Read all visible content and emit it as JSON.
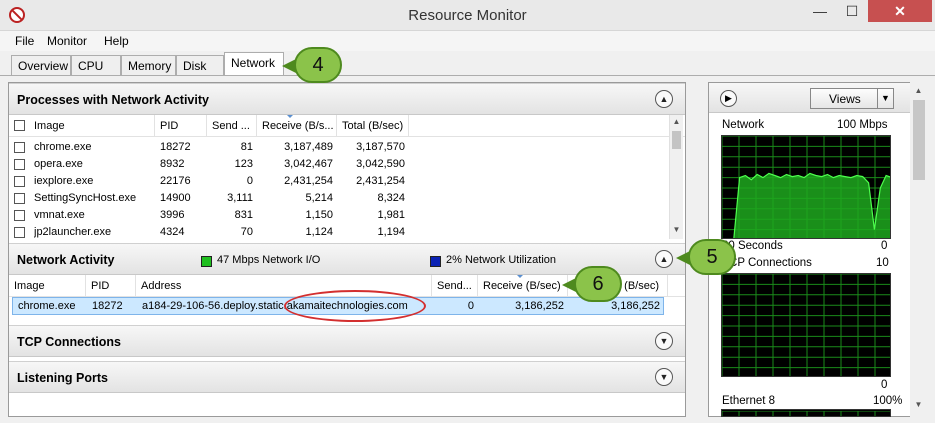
{
  "window": {
    "title": "Resource Monitor",
    "min": "—",
    "max": "☐",
    "close": "✕"
  },
  "menu": [
    "File",
    "Monitor",
    "Help"
  ],
  "tabs": [
    "Overview",
    "CPU",
    "Memory",
    "Disk",
    "Network"
  ],
  "processes": {
    "title": "Processes with Network Activity",
    "headers": [
      "Image",
      "PID",
      "Send ...",
      "Receive (B/s...",
      "Total (B/sec)"
    ],
    "rows": [
      [
        "chrome.exe",
        "18272",
        "81",
        "3,187,489",
        "3,187,570"
      ],
      [
        "opera.exe",
        "8932",
        "123",
        "3,042,467",
        "3,042,590"
      ],
      [
        "iexplore.exe",
        "22176",
        "0",
        "2,431,254",
        "2,431,254"
      ],
      [
        "SettingSyncHost.exe",
        "14900",
        "3,111",
        "5,214",
        "8,324"
      ],
      [
        "vmnat.exe",
        "3996",
        "831",
        "1,150",
        "1,981"
      ],
      [
        "jp2launcher.exe",
        "4324",
        "70",
        "1,124",
        "1,194"
      ]
    ]
  },
  "network_activity": {
    "title": "Network Activity",
    "io_label": "47 Mbps Network I/O",
    "util_label": "2% Network Utilization",
    "io_color": "#1fbf1f",
    "util_color": "#0a22b4",
    "headers": [
      "Image",
      "PID",
      "Address",
      "Send...",
      "Receive (B/sec)",
      "(B/sec)"
    ],
    "rows": [
      [
        "chrome.exe",
        "18272",
        "a184-29-106-56.deploy.static.akamaitechnologies.com",
        "0",
        "3,186,252",
        "3,186,252"
      ]
    ]
  },
  "tcp": {
    "title": "TCP Connections"
  },
  "listening": {
    "title": "Listening Ports"
  },
  "right": {
    "views_label": "Views",
    "network_graph": {
      "label": "Network",
      "max": "100 Mbps",
      "footer_left": "60 Seconds",
      "footer_right": "0"
    },
    "tcp_graph": {
      "label": "TCP Connections",
      "max": "10",
      "footer_right": "0"
    },
    "ethernet_graph": {
      "label": "Ethernet 8",
      "max": "100%"
    }
  },
  "callouts": [
    "4",
    "5",
    "6"
  ],
  "colors": {
    "graph_grid": "#1a8a1a",
    "graph_fill": "#1fa81f",
    "graph_line": "#4dff4d",
    "callout": "#8bc34a"
  }
}
